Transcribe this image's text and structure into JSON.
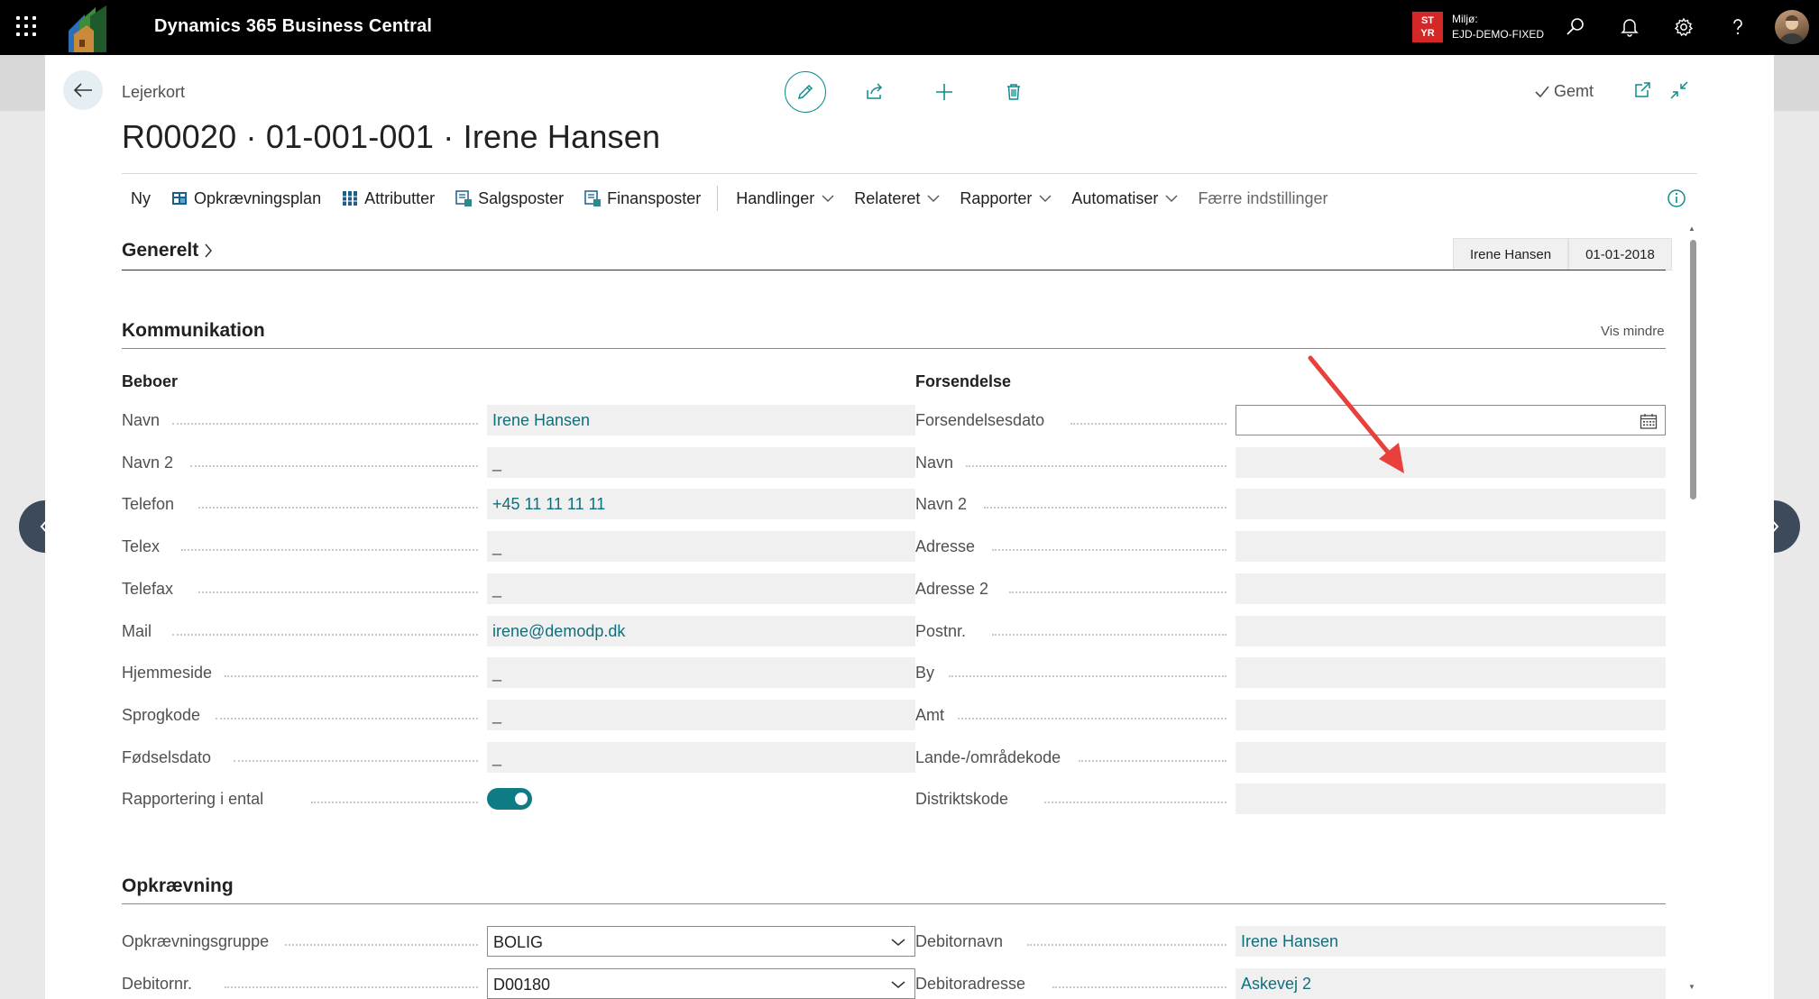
{
  "topbar": {
    "app_title": "Dynamics 365 Business Central",
    "env_badge": "ST YR",
    "env_label": "Miljø:",
    "env_name": "EJD-DEMO-FIXED"
  },
  "header": {
    "breadcrumb": "Lejerkort",
    "title": "R00020 · 01-001-001 · Irene Hansen",
    "saved": "Gemt"
  },
  "actionbar": {
    "items": [
      "Ny",
      "Opkrævningsplan",
      "Attributter",
      "Salgsposter",
      "Finansposter"
    ],
    "menus": [
      "Handlinger",
      "Relateret",
      "Rapporter",
      "Automatiser"
    ],
    "fewer": "Færre indstillinger"
  },
  "generelt": {
    "title": "Generelt",
    "badges": [
      "Irene Hansen",
      "01-01-2018"
    ]
  },
  "kommunikation": {
    "title": "Kommunikation",
    "show_less": "Vis mindre",
    "beboer": {
      "label": "Beboer",
      "fields": [
        {
          "label": "Navn",
          "value": "Irene Hansen"
        },
        {
          "label": "Navn 2",
          "value": "_"
        },
        {
          "label": "Telefon",
          "value": "+45 11 11 11 11"
        },
        {
          "label": "Telex",
          "value": "_"
        },
        {
          "label": "Telefax",
          "value": "_"
        },
        {
          "label": "Mail",
          "value": "irene@demodp.dk"
        },
        {
          "label": "Hjemmeside",
          "value": "_"
        },
        {
          "label": "Sprogkode",
          "value": "_"
        },
        {
          "label": "Fødselsdato",
          "value": "_"
        },
        {
          "label": "Rapportering i ental",
          "value": true
        }
      ]
    },
    "forsendelse": {
      "label": "Forsendelse",
      "fields": [
        {
          "label": "Forsendelsesdato",
          "value": ""
        },
        {
          "label": "Navn",
          "value": ""
        },
        {
          "label": "Navn 2",
          "value": ""
        },
        {
          "label": "Adresse",
          "value": ""
        },
        {
          "label": "Adresse 2",
          "value": ""
        },
        {
          "label": "Postnr.",
          "value": ""
        },
        {
          "label": "By",
          "value": ""
        },
        {
          "label": "Amt",
          "value": ""
        },
        {
          "label": "Lande-/områdekode",
          "value": ""
        },
        {
          "label": "Distriktskode",
          "value": ""
        }
      ]
    }
  },
  "opkraevning": {
    "title": "Opkrævning",
    "left": [
      {
        "label": "Opkrævningsgruppe",
        "value": "BOLIG"
      },
      {
        "label": "Debitornr.",
        "value": "D00180"
      }
    ],
    "right": [
      {
        "label": "Debitornavn",
        "value": "Irene Hansen"
      },
      {
        "label": "Debitoradresse",
        "value": "Askevej 2"
      }
    ]
  },
  "colors": {
    "accent": "#0f8b8d",
    "topbar": "#000000",
    "link_value": "#0f6f7c",
    "annotation": "#e8403a"
  }
}
